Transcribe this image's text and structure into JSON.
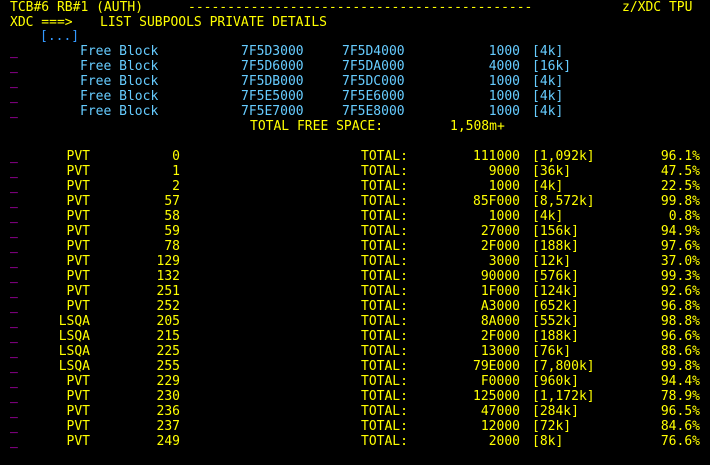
{
  "header": {
    "left": "TCB#6 RB#1 (AUTH)",
    "dashes": "--------------------------------------------",
    "right": "z/XDC TPU"
  },
  "command": {
    "prompt": "XDC ===>",
    "text": "LIST SUBPOOLS PRIVATE DETAILS"
  },
  "ellipsis": "[...]",
  "cursor_mark": "_",
  "free_blocks": [
    {
      "label": "Free Block",
      "start": "7F5D3000",
      "end": "7F5D4000",
      "size": "1000",
      "kb": "[4k]"
    },
    {
      "label": "Free Block",
      "start": "7F5D6000",
      "end": "7F5DA000",
      "size": "4000",
      "kb": "[16k]"
    },
    {
      "label": "Free Block",
      "start": "7F5DB000",
      "end": "7F5DC000",
      "size": "1000",
      "kb": "[4k]"
    },
    {
      "label": "Free Block",
      "start": "7F5E5000",
      "end": "7F5E6000",
      "size": "1000",
      "kb": "[4k]"
    },
    {
      "label": "Free Block",
      "start": "7F5E7000",
      "end": "7F5E8000",
      "size": "1000",
      "kb": "[4k]"
    }
  ],
  "free_total": {
    "label": "TOTAL FREE SPACE:",
    "value": "1,508m+"
  },
  "subpools": [
    {
      "type": "PVT",
      "num": "0",
      "total_label": "TOTAL:",
      "size": "111000",
      "kb": "[1,092k]",
      "pct": "96.1%"
    },
    {
      "type": "PVT",
      "num": "1",
      "total_label": "TOTAL:",
      "size": "9000",
      "kb": "[36k]",
      "pct": "47.5%"
    },
    {
      "type": "PVT",
      "num": "2",
      "total_label": "TOTAL:",
      "size": "1000",
      "kb": "[4k]",
      "pct": "22.5%"
    },
    {
      "type": "PVT",
      "num": "57",
      "total_label": "TOTAL:",
      "size": "85F000",
      "kb": "[8,572k]",
      "pct": "99.8%"
    },
    {
      "type": "PVT",
      "num": "58",
      "total_label": "TOTAL:",
      "size": "1000",
      "kb": "[4k]",
      "pct": "0.8%"
    },
    {
      "type": "PVT",
      "num": "59",
      "total_label": "TOTAL:",
      "size": "27000",
      "kb": "[156k]",
      "pct": "94.9%"
    },
    {
      "type": "PVT",
      "num": "78",
      "total_label": "TOTAL:",
      "size": "2F000",
      "kb": "[188k]",
      "pct": "97.6%"
    },
    {
      "type": "PVT",
      "num": "129",
      "total_label": "TOTAL:",
      "size": "3000",
      "kb": "[12k]",
      "pct": "37.0%"
    },
    {
      "type": "PVT",
      "num": "132",
      "total_label": "TOTAL:",
      "size": "90000",
      "kb": "[576k]",
      "pct": "99.3%"
    },
    {
      "type": "PVT",
      "num": "251",
      "total_label": "TOTAL:",
      "size": "1F000",
      "kb": "[124k]",
      "pct": "92.6%"
    },
    {
      "type": "PVT",
      "num": "252",
      "total_label": "TOTAL:",
      "size": "A3000",
      "kb": "[652k]",
      "pct": "96.8%"
    },
    {
      "type": "LSQA",
      "num": "205",
      "total_label": "TOTAL:",
      "size": "8A000",
      "kb": "[552k]",
      "pct": "98.8%"
    },
    {
      "type": "LSQA",
      "num": "215",
      "total_label": "TOTAL:",
      "size": "2F000",
      "kb": "[188k]",
      "pct": "96.6%"
    },
    {
      "type": "LSQA",
      "num": "225",
      "total_label": "TOTAL:",
      "size": "13000",
      "kb": "[76k]",
      "pct": "88.6%"
    },
    {
      "type": "LSQA",
      "num": "255",
      "total_label": "TOTAL:",
      "size": "79E000",
      "kb": "[7,800k]",
      "pct": "99.8%"
    },
    {
      "type": "PVT",
      "num": "229",
      "total_label": "TOTAL:",
      "size": "F0000",
      "kb": "[960k]",
      "pct": "94.4%"
    },
    {
      "type": "PVT",
      "num": "230",
      "total_label": "TOTAL:",
      "size": "125000",
      "kb": "[1,172k]",
      "pct": "78.9%"
    },
    {
      "type": "PVT",
      "num": "236",
      "total_label": "TOTAL:",
      "size": "47000",
      "kb": "[284k]",
      "pct": "96.5%"
    },
    {
      "type": "PVT",
      "num": "237",
      "total_label": "TOTAL:",
      "size": "12000",
      "kb": "[72k]",
      "pct": "84.6%"
    },
    {
      "type": "PVT",
      "num": "249",
      "total_label": "TOTAL:",
      "size": "2000",
      "kb": "[8k]",
      "pct": "76.6%"
    }
  ],
  "colors": {
    "background": "#000000",
    "header": "#ffff00",
    "free_block": "#66ccff",
    "subpool": "#ffff00",
    "cursor": "#ff00ff",
    "ellipsis": "#3399ff"
  }
}
